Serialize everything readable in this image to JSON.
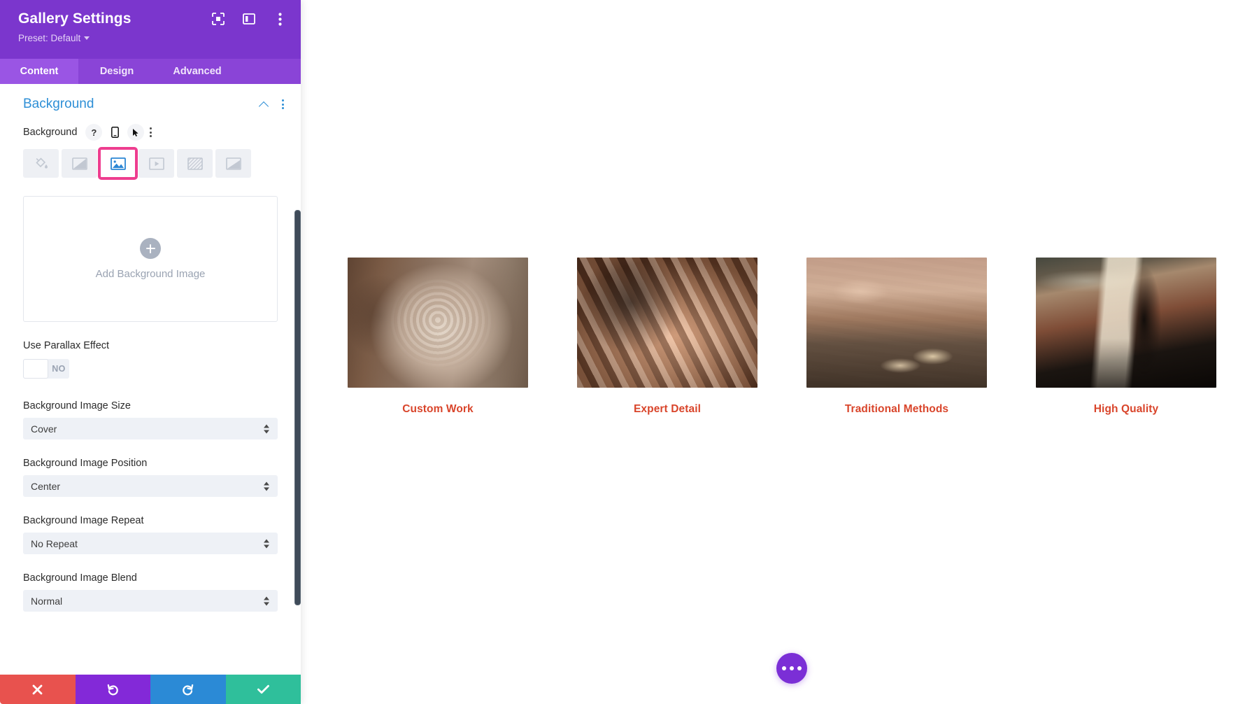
{
  "panel": {
    "title": "Gallery Settings",
    "preset_label": "Preset: Default",
    "header_icons": [
      {
        "name": "fullscreen-icon"
      },
      {
        "name": "layout-panel-icon"
      },
      {
        "name": "more-vertical-icon"
      }
    ],
    "tabs": [
      {
        "label": "Content",
        "active": true
      },
      {
        "label": "Design",
        "active": false
      },
      {
        "label": "Advanced",
        "active": false
      }
    ],
    "section": {
      "title": "Background",
      "collapse_icon": "chevron-up-icon",
      "more_icon": "more-vertical-icon"
    },
    "background_field": {
      "label": "Background",
      "help_icon": "?",
      "responsive_icon": "phone-icon",
      "hover_icon": "cursor-icon",
      "more_icon": "more-vertical-icon"
    },
    "bg_types": [
      {
        "name": "background-color",
        "icon": "paint-bucket-icon",
        "selected": false
      },
      {
        "name": "background-gradient",
        "icon": "gradient-icon",
        "selected": false
      },
      {
        "name": "background-image",
        "icon": "image-icon",
        "selected": true
      },
      {
        "name": "background-video",
        "icon": "video-icon",
        "selected": false
      },
      {
        "name": "background-pattern",
        "icon": "pattern-icon",
        "selected": false
      },
      {
        "name": "background-mask",
        "icon": "mask-icon",
        "selected": false
      }
    ],
    "dropzone": {
      "label": "Add Background Image",
      "icon": "plus-icon"
    },
    "fields": [
      {
        "label": "Use Parallax Effect",
        "type": "toggle",
        "value": "NO"
      },
      {
        "label": "Background Image Size",
        "type": "select",
        "value": "Cover"
      },
      {
        "label": "Background Image Position",
        "type": "select",
        "value": "Center"
      },
      {
        "label": "Background Image Repeat",
        "type": "select",
        "value": "No Repeat"
      },
      {
        "label": "Background Image Blend",
        "type": "select",
        "value": "Normal"
      }
    ],
    "actions": [
      {
        "name": "cancel",
        "icon": "close-icon",
        "color": "#e8524e"
      },
      {
        "name": "undo",
        "icon": "undo-icon",
        "color": "#8329d8"
      },
      {
        "name": "redo",
        "icon": "redo-icon",
        "color": "#2b8ad6"
      },
      {
        "name": "save",
        "icon": "check-icon",
        "color": "#2fbf9b"
      }
    ]
  },
  "stage": {
    "gallery": [
      {
        "caption": "Custom Work",
        "image": "carved-wooden-chair-back"
      },
      {
        "caption": "Expert Detail",
        "image": "carved-wood-floral-detail"
      },
      {
        "caption": "Traditional Methods",
        "image": "hands-carving-with-chisels"
      },
      {
        "caption": "High Quality",
        "image": "clamp-on-workbench"
      }
    ],
    "caption_color": "#d9452b",
    "fab": {
      "icon": "more-horizontal-icon",
      "color": "#7b2fd6"
    }
  },
  "theme": {
    "panel_header": "#7b36cd",
    "tab_bar": "#8a44d7",
    "tab_active": "#9a55e4",
    "section_title": "#2e8fd6",
    "selection_highlight": "#ee3d8f"
  }
}
